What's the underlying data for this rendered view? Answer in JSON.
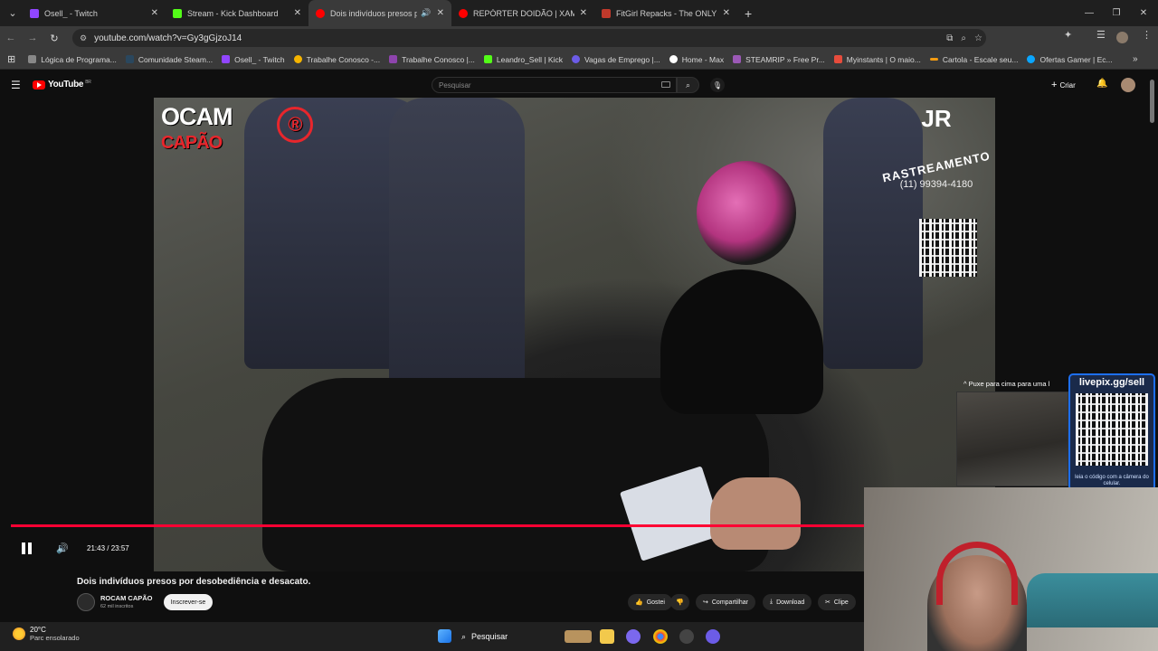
{
  "browser": {
    "tabs": [
      {
        "title": "Osell_ - Twitch",
        "color": "#9146ff",
        "active": false,
        "audio": false
      },
      {
        "title": "Stream - Kick Dashboard",
        "color": "#53fc18",
        "active": false,
        "audio": false
      },
      {
        "title": "Dois indivíduos presos por",
        "color": "#ff0000",
        "active": true,
        "audio": true
      },
      {
        "title": "REPÓRTER DOIDÃO | XAMUEL",
        "color": "#ff0000",
        "active": false,
        "audio": false
      },
      {
        "title": "FitGirl Repacks - The ONLY offic",
        "color": "#c0392b",
        "active": false,
        "audio": false
      }
    ],
    "url": "youtube.com/watch?v=Gy3gGjzoJ14",
    "bookmarks": [
      {
        "label": "Lógica de Programa...",
        "color": "#888888"
      },
      {
        "label": "Comunidade Steam...",
        "color": "#2a475e"
      },
      {
        "label": "Osell_ - Twitch",
        "color": "#9146ff"
      },
      {
        "label": "Trabalhe Conosco -...",
        "color": "#f5b400"
      },
      {
        "label": "Trabalhe Conosco |...",
        "color": "#8e44ad"
      },
      {
        "label": "Leandro_Sell | Kick",
        "color": "#53fc18"
      },
      {
        "label": "Vagas de Emprego |...",
        "color": "#6c5ce7"
      },
      {
        "label": "Home - Max",
        "color": "#ffffff"
      },
      {
        "label": "STEAMRIP » Free Pr...",
        "color": "#9b59b6"
      },
      {
        "label": "Myinstants | O maio...",
        "color": "#e74c3c"
      },
      {
        "label": "Cartola - Escale seu...",
        "color": "#f39c12"
      },
      {
        "label": "Ofertas Gamer | Ec...",
        "color": "#0aa6ff"
      }
    ]
  },
  "youtube": {
    "logo": "YouTube",
    "region": "BR",
    "search_placeholder": "Pesquisar",
    "create_label": "Criar",
    "video": {
      "channel_logo_text": "OCAM",
      "channel_logo_sub": "CAPÃO",
      "sponsor_title": "JR",
      "sponsor_sub": "RASTREAMENTO",
      "sponsor_phone": "(11) 99394-4180",
      "time_current": "21:43",
      "time_total": "23:57",
      "progress": 0.907
    },
    "title": "Dois indivíduos presos por desobediência e desacato.",
    "channel_name": "ROCAM CAPÃO",
    "subscribers": "62 mil inscritos",
    "subscribe_label": "Inscrever-se",
    "actions": {
      "like": "Gostei",
      "share": "Compartilhar",
      "download": "Download",
      "clip": "Clipe"
    }
  },
  "stream_overlay": {
    "swipe_text": "Puxe para cima para uma l",
    "livepix_url": "livepix.gg/sell",
    "livepix_caption": "leia o código com a câmera do celular."
  },
  "taskbar": {
    "temperature": "20°C",
    "weather": "Parc ensolarado",
    "search_label": "Pesquisar"
  }
}
